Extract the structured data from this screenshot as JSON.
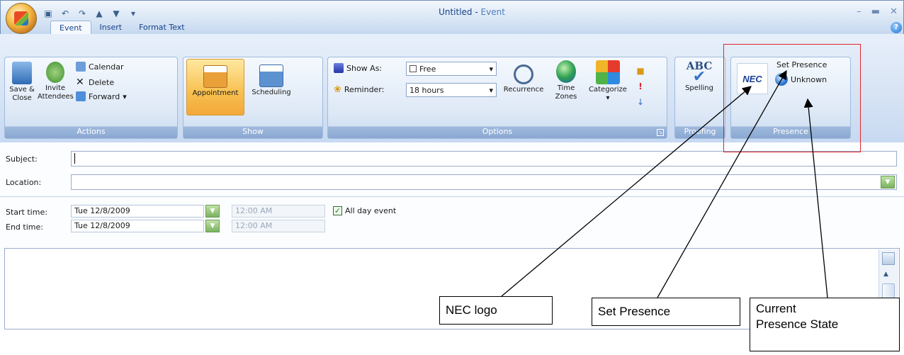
{
  "window": {
    "title_doc": "Untitled",
    "title_sep": " - ",
    "title_app": "Event"
  },
  "tabs": [
    {
      "label": "Event",
      "active": true
    },
    {
      "label": "Insert"
    },
    {
      "label": "Format Text"
    }
  ],
  "ribbon": {
    "actions": {
      "label": "Actions",
      "save_close": "Save &\nClose",
      "invite": "Invite\nAttendees",
      "calendar": "Calendar",
      "delete": "Delete",
      "forward": "Forward"
    },
    "show": {
      "label": "Show",
      "appointment": "Appointment",
      "scheduling": "Scheduling"
    },
    "options": {
      "label": "Options",
      "show_as_label": "Show As:",
      "show_as_value": "Free",
      "reminder_label": "Reminder:",
      "reminder_value": "18 hours",
      "recurrence": "Recurrence",
      "time_zones": "Time\nZones",
      "categorize": "Categorize"
    },
    "proofing": {
      "label": "Proofing",
      "spelling": "Spelling",
      "abc": "ABC"
    },
    "presence": {
      "label": "Presence",
      "nec": "NEC",
      "set_presence": "Set Presence",
      "unknown": "Unknown"
    }
  },
  "form": {
    "subject_label": "Subject:",
    "location_label": "Location:",
    "start_label": "Start time:",
    "end_label": "End time:",
    "start_date": "Tue 12/8/2009",
    "end_date": "Tue 12/8/2009",
    "start_time": "12:00 AM",
    "end_time": "12:00 AM",
    "all_day_label": "All day event",
    "all_day_checked": true
  },
  "callouts": {
    "nec_logo": "NEC logo",
    "set_presence": "Set Presence",
    "current_state_line1": "Current",
    "current_state_line2": "Presence State"
  },
  "colors": {
    "annotation_box": "#e0262a",
    "ribbon_accent": "#f6b840",
    "title_text": "#15428b"
  }
}
